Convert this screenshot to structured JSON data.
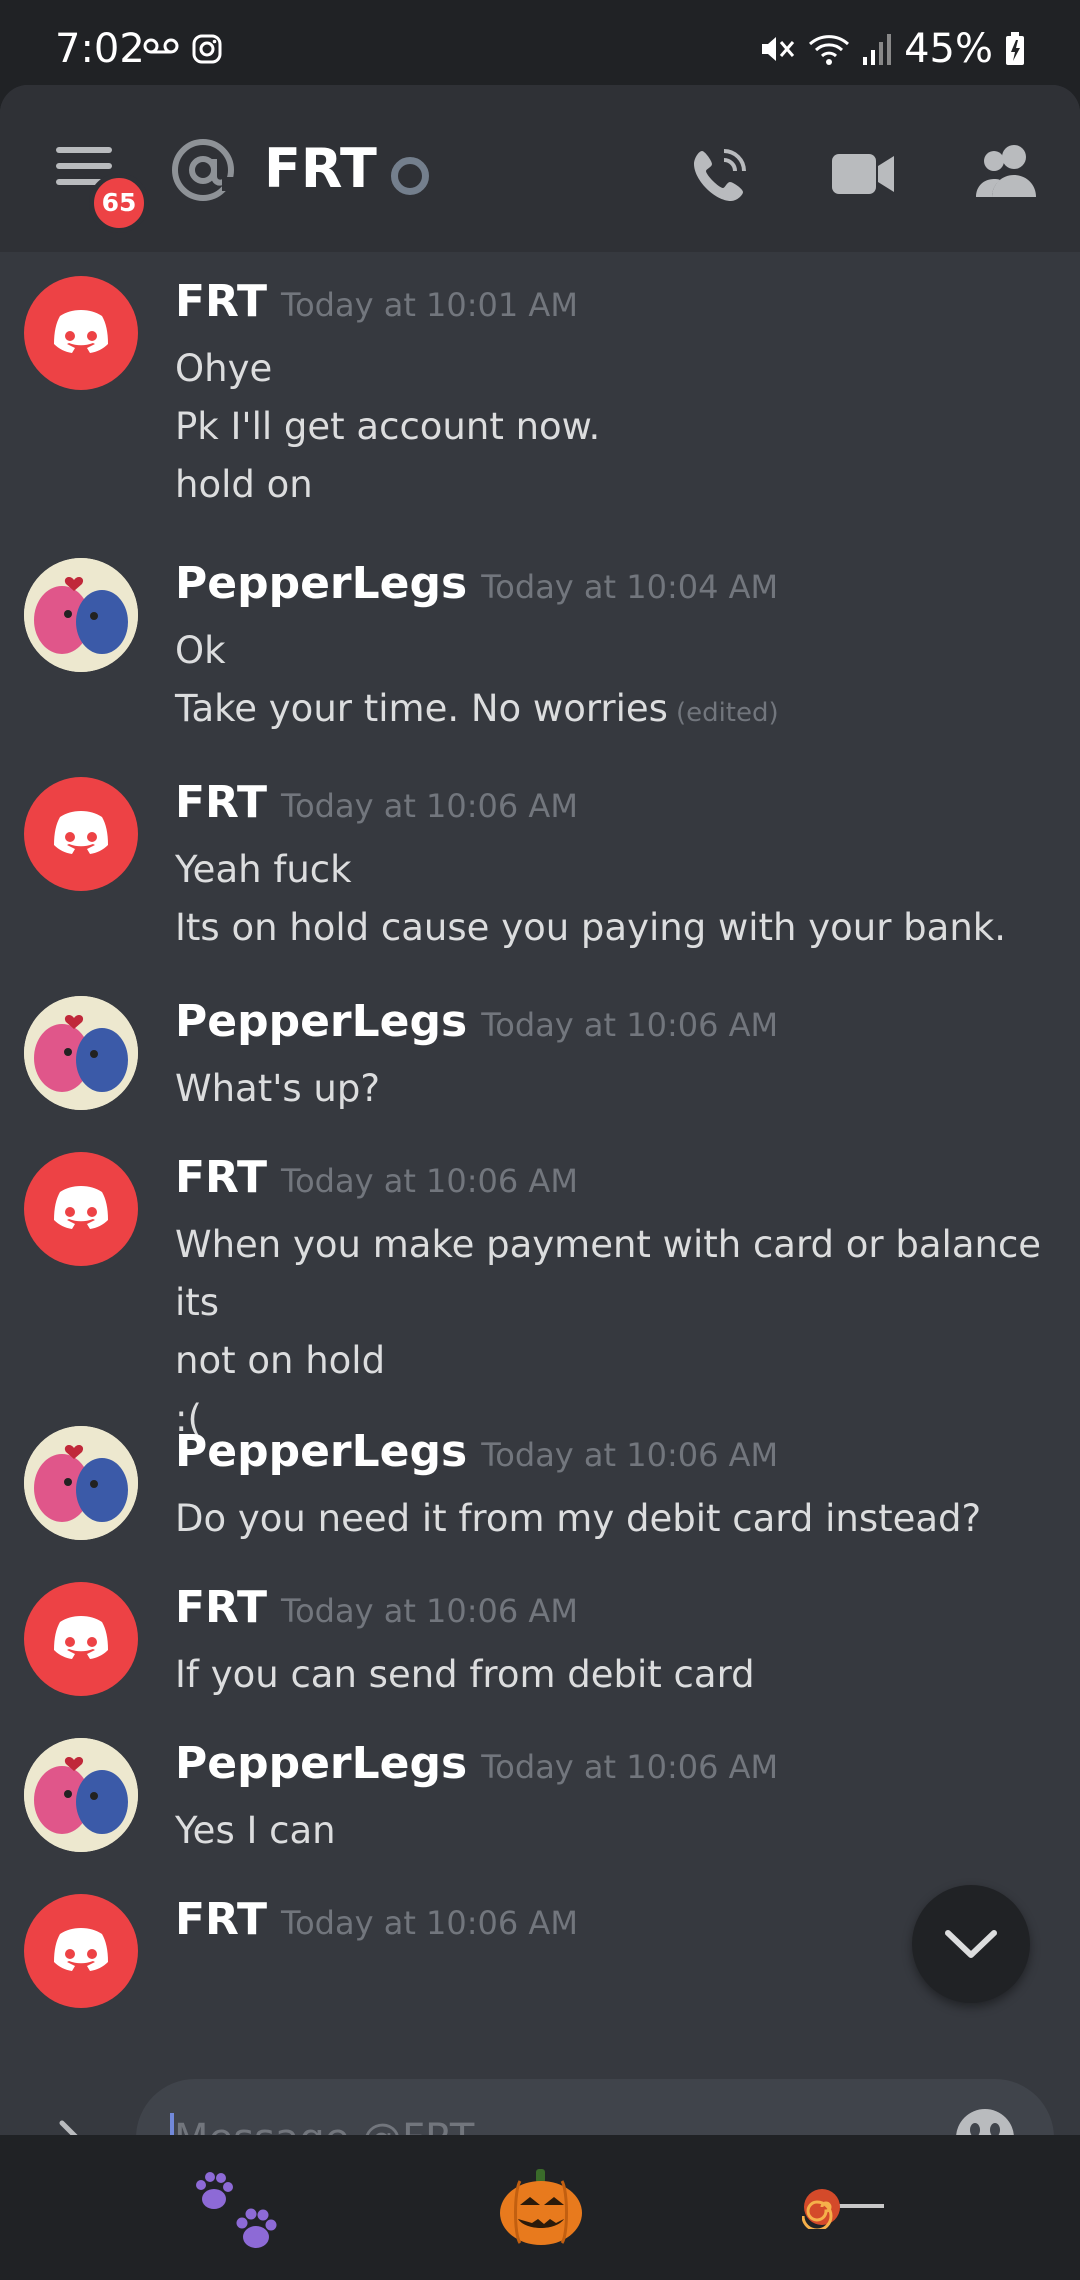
{
  "status_bar": {
    "time": "7:02",
    "battery": "45%"
  },
  "header": {
    "badge_count": "65",
    "channel_name": "FRT"
  },
  "messages": [
    {
      "user": "FRT",
      "time": "Today at 10:01 AM",
      "lines": [
        "Ohye",
        "Pk I'll get account now.",
        "hold on"
      ]
    },
    {
      "user": "PepperLegs",
      "time": "Today at 10:04 AM",
      "lines": [
        "Ok",
        "Take your time. No worries"
      ],
      "edited": "(edited)"
    },
    {
      "user": "FRT",
      "time": "Today at 10:06 AM",
      "lines": [
        "Yeah fuck",
        "Its on hold cause you paying with your bank."
      ]
    },
    {
      "user": "PepperLegs",
      "time": "Today at 10:06 AM",
      "lines": [
        "What's up?"
      ]
    },
    {
      "user": "FRT",
      "time": "Today at 10:06 AM",
      "lines": [
        "When you make payment with card or balance its",
        "not on hold",
        ":("
      ]
    },
    {
      "user": "PepperLegs",
      "time": "Today at 10:06 AM",
      "lines": [
        "Do you need it from my debit card instead?"
      ]
    },
    {
      "user": "FRT",
      "time": "Today at 10:06 AM",
      "lines": [
        "If you can send from debit card"
      ]
    },
    {
      "user": "PepperLegs",
      "time": "Today at 10:06 AM",
      "lines": [
        "Yes I can"
      ]
    },
    {
      "user": "FRT",
      "time": "Today at 10:06 AM",
      "lines": []
    }
  ],
  "composer": {
    "placeholder": "Message @FRT"
  },
  "icons": {
    "menu": "hamburger-menu-icon",
    "at": "at-sign-icon",
    "call": "phone-call-icon",
    "video": "video-camera-icon",
    "members": "members-icon",
    "expand": "chevron-right-icon",
    "emoji": "smiley-face-icon",
    "scroll": "chevron-down-icon",
    "dock": [
      "paw-prints-icon",
      "jack-o-lantern-icon",
      "lollipop-icon"
    ]
  },
  "colors": {
    "brand_red": "#ed4245",
    "background": "#36393f",
    "header": "#2f3136",
    "input": "#40444b",
    "accent": "#7289da"
  }
}
